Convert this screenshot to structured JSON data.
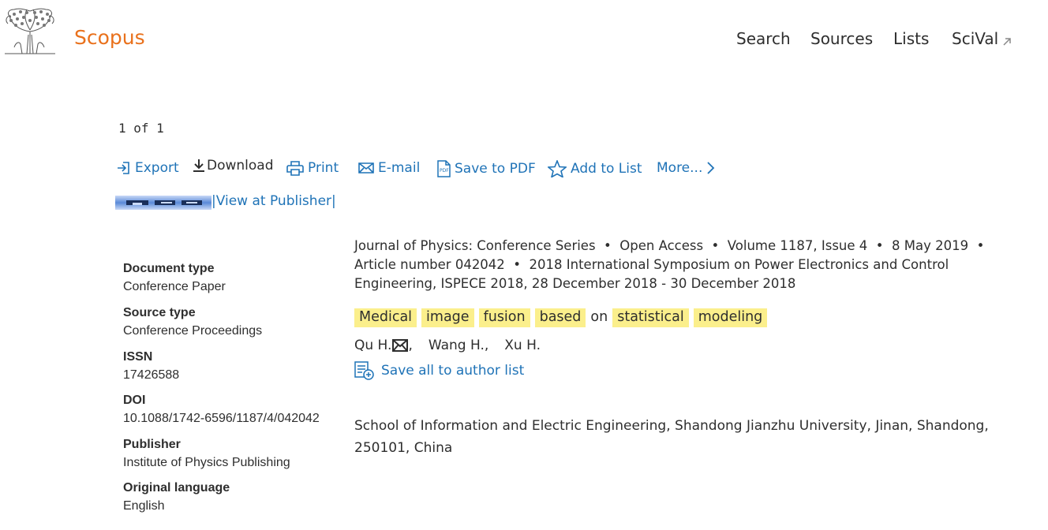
{
  "header": {
    "logo_icon": "elsevier-tree-logo",
    "brand": "Scopus",
    "brand_color": "#e9711c",
    "nav": {
      "search": "Search",
      "sources": "Sources",
      "lists": "Lists",
      "scival": "SciVal"
    }
  },
  "paging": "1 of 1",
  "toolbar": {
    "export": "Export",
    "download": "Download",
    "print": "Print",
    "email": "E-mail",
    "save_pdf": "Save to PDF",
    "add_list": "Add to List",
    "more": "More..."
  },
  "publisher_link": {
    "separator_left": "|",
    "label": "View at Publisher",
    "separator_right": "|"
  },
  "details": {
    "document_type_label": "Document type",
    "document_type": "Conference Paper",
    "source_type_label": "Source type",
    "source_type": "Conference Proceedings",
    "issn_label": "ISSN",
    "issn": "17426588",
    "doi_label": "DOI",
    "doi": "10.1088/1742-6596/1187/4/042042",
    "publisher_label": "Publisher",
    "publisher": "Institute of Physics Publishing",
    "language_label": "Original language",
    "language": "English"
  },
  "source_info": "Journal of Physics: Conference Series  •  Open Access  •  Volume 1187, Issue 4  •  8 May 2019  •  Article number 042042  •  2018 International Symposium on Power Electronics and Control Engineering, ISPECE 2018, 28 December 2018 - 30 December 2018",
  "title_words": {
    "w1": "Medical",
    "w2": "image",
    "w3": "fusion",
    "w4": "based",
    "w5": "on",
    "w6": "statistical",
    "w7": "modeling"
  },
  "highlight_color": "#fbef8c",
  "authors": {
    "a1": "Qu H.",
    "sep1": ",",
    "a2": "Wang H.,",
    "a3": "Xu H."
  },
  "save_author": "Save all to author list",
  "affiliation": "School of Information and Electric Engineering, Shandong Jianzhu University, Jinan, Shandong, 250101, China",
  "link_color": "#1f73b7"
}
